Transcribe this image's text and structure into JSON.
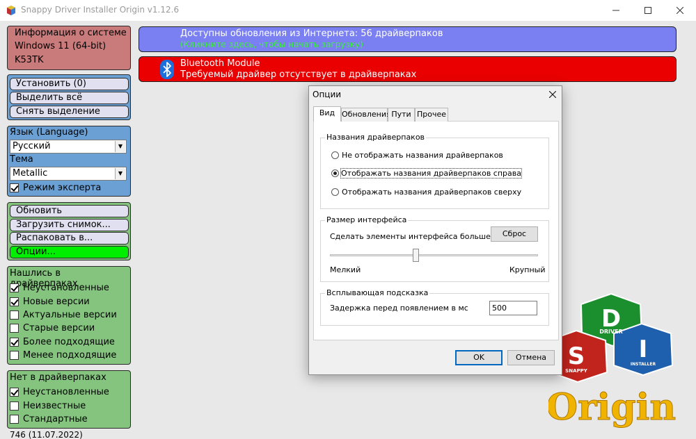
{
  "window": {
    "title": "Snappy Driver Installer Origin v1.12.6"
  },
  "system_info": {
    "heading": "Информация о системе",
    "os": "Windows 11 (64-bit)",
    "computer": "K53TK"
  },
  "actions": {
    "install": "Установить (0)",
    "select_all": "Выделить всё",
    "deselect": "Снять выделение"
  },
  "language": {
    "label": "Язык (Language)",
    "value": "Русский"
  },
  "theme": {
    "label": "Тема",
    "value": "Metallic"
  },
  "expert_mode": {
    "label": "Режим эксперта",
    "checked": true
  },
  "tools": {
    "refresh": "Обновить",
    "load_snapshot": "Загрузить снимок...",
    "extract": "Распаковать в...",
    "options": "Опции..."
  },
  "found_filters": {
    "heading": "Нашлись в драйверпаках",
    "items": [
      {
        "label": "Неустановленные",
        "checked": true
      },
      {
        "label": "Новые версии",
        "checked": true
      },
      {
        "label": "Актуальные версии",
        "checked": false
      },
      {
        "label": "Старые версии",
        "checked": false
      },
      {
        "label": "Более подходящие",
        "checked": true
      },
      {
        "label": "Менее подходящие",
        "checked": false
      }
    ]
  },
  "missing_filters": {
    "heading": "Нет в драйверпаках",
    "items": [
      {
        "label": "Неустановленные",
        "checked": true
      },
      {
        "label": "Неизвестные",
        "checked": false
      },
      {
        "label": "Стандартные",
        "checked": false
      }
    ]
  },
  "footer": {
    "version": "746 (11.07.2022)"
  },
  "update_banner": {
    "title": "Доступны обновления из Интернета: 56 драйверпаков",
    "subtitle": "(Кликните здесь, чтобы начать загрузку)"
  },
  "bluetooth_banner": {
    "title": "Bluetooth Module",
    "subtitle": "Требуемый драйвер отсутствует в драйверпаках"
  },
  "dialog": {
    "title": "Опции",
    "tabs": [
      "Вид",
      "Обновления",
      "Пути",
      "Прочее"
    ],
    "names_group": {
      "label": "Названия драйверпаков",
      "options": [
        {
          "label": "Не отображать названия драйверпаков",
          "selected": false
        },
        {
          "label": "Отображать названия драйверпаков справа",
          "selected": true
        },
        {
          "label": "Отображать названия драйверпаков сверху",
          "selected": false
        }
      ]
    },
    "size_group": {
      "label": "Размер интерфейса",
      "description": "Сделать элементы интерфейса больше или мень",
      "reset": "Сброс",
      "min_label": "Мелкий",
      "max_label": "Крупный",
      "level": 0.41
    },
    "tooltip_group": {
      "label": "Всплывающая подсказка",
      "delay_label": "Задержка перед появлением в мс",
      "delay_value": "500"
    },
    "ok": "OK",
    "cancel": "Отмена"
  },
  "logo": {
    "letters": [
      "D",
      "S",
      "I"
    ],
    "words": [
      "DRIVER",
      "SNAPPY",
      "INSTALLER"
    ],
    "brand": "Origin"
  },
  "colors": {
    "update_banner": "#7a7ff2",
    "bluetooth_banner": "#ea0000",
    "options_button": "#00ee00",
    "system_panel": "#c97b7b",
    "settings_panel": "#6aa0d4",
    "filter_panel": "#85c47f",
    "link_green": "#3ef03e"
  }
}
